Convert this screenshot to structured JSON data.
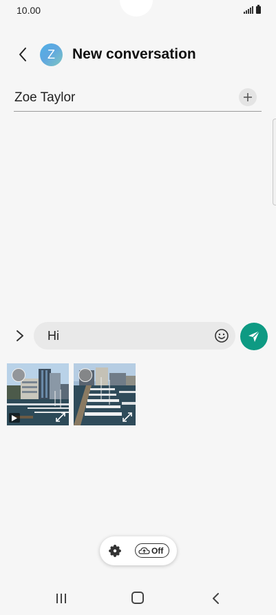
{
  "status_bar": {
    "time": "10.00"
  },
  "header": {
    "avatar_letter": "Z",
    "title": "New conversation"
  },
  "recipient": {
    "name": "Zoe Taylor"
  },
  "composer": {
    "message": "Hi"
  },
  "floating_pill": {
    "cloud_label": "Off"
  },
  "colors": {
    "send": "#0e9a83",
    "avatar_start": "#4fb0e6",
    "avatar_end": "#7fc6c1"
  }
}
